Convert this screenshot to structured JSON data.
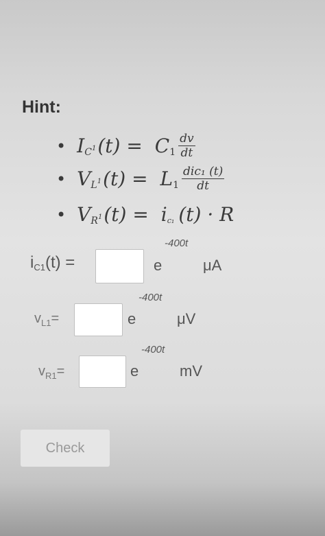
{
  "hint": {
    "title": "Hint:",
    "formulas": [
      {
        "lhs": "I",
        "lhs_sub": "C",
        "lhs_sub2": "1",
        "arg": "(t) =",
        "rhs": "C",
        "rhs_sub": "1",
        "num": "dv",
        "den": "dt"
      },
      {
        "lhs": "V",
        "lhs_sub": "L",
        "lhs_sub2": "1",
        "arg": "(t) =",
        "rhs": "L",
        "rhs_sub": "1",
        "num": "dic₁ (t)",
        "den": "dt"
      },
      {
        "lhs": "V",
        "lhs_sub": "R",
        "lhs_sub2": "1",
        "arg": "(t) =",
        "rhs": "i",
        "rhs_sub": "c₁",
        "tail": "(t) · R"
      }
    ]
  },
  "inputs": [
    {
      "label_main": "i",
      "label_sub": "C1",
      "label_tail": "(t) =",
      "exponent": "-400t",
      "base": "e",
      "unit": "μA",
      "value": ""
    },
    {
      "label_main": "v",
      "label_sub": "L1",
      "label_tail": " =",
      "exponent": "-400t",
      "base": "e",
      "unit": "μV",
      "value": ""
    },
    {
      "label_main": "v",
      "label_sub": "R1",
      "label_tail": " =",
      "exponent": "-400t",
      "base": "e",
      "unit": "mV",
      "value": ""
    }
  ],
  "check_label": "Check"
}
